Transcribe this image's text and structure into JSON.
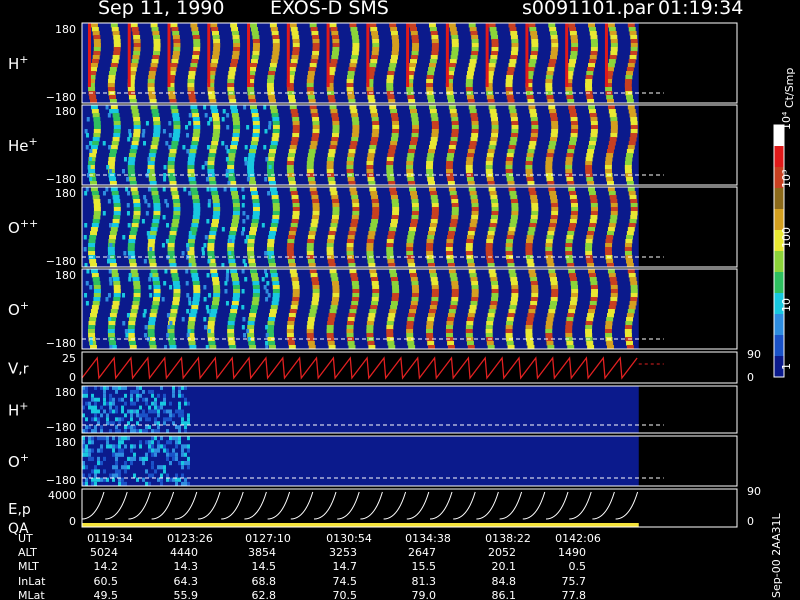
{
  "header": {
    "date": "Sep 11, 1990",
    "instrument": "EXOS-D SMS",
    "file": "s0091101.par",
    "time": "01:19:34"
  },
  "sponsor": "Sep-00 2AA31L",
  "colors": {
    "background": "#000000",
    "no_data": "#0b1a8c",
    "axis": "#ffffff",
    "velocity_trace": "#e02020",
    "energy_trace": "#ffffff",
    "qa_bar": "#f5e33a",
    "reference_line": "#ffffff"
  },
  "colorbar": {
    "unit": "Ct/Smp",
    "tick_labels": [
      "1",
      "10",
      "100",
      "10³",
      "10⁴"
    ],
    "scale": "log",
    "range": [
      1,
      10000
    ]
  },
  "chart_data": {
    "type": "heatmap",
    "title": "Sep 11, 1990  EXOS-D SMS",
    "x_axis": {
      "name": "UT",
      "tick_labels": [
        "0119:34",
        "0123:26",
        "0127:10",
        "0130:54",
        "0134:38",
        "0138:22",
        "0142:06"
      ]
    },
    "ephemeris": [
      {
        "name": "UT",
        "values": [
          "0119:34",
          "0123:26",
          "0127:10",
          "0130:54",
          "0134:38",
          "0138:22",
          "0142:06"
        ]
      },
      {
        "name": "ALT",
        "values": [
          "5024",
          "4440",
          "3854",
          "3253",
          "2647",
          "2052",
          "1490"
        ]
      },
      {
        "name": "MLT",
        "values": [
          "14.2",
          "14.3",
          "14.5",
          "14.7",
          "15.5",
          "20.1",
          "0.5"
        ]
      },
      {
        "name": "InLat",
        "values": [
          "60.5",
          "64.3",
          "68.8",
          "74.5",
          "81.3",
          "84.8",
          "75.7"
        ]
      },
      {
        "name": "MLat",
        "values": [
          "49.5",
          "55.9",
          "62.8",
          "70.5",
          "79.0",
          "86.1",
          "77.8"
        ]
      }
    ],
    "panels": [
      {
        "label": "H",
        "label_sup": "+",
        "kind": "angle_spectrogram",
        "y_top": "180",
        "y_bottom": "−180",
        "intensity": "high",
        "data_end_fraction": 0.85
      },
      {
        "label": "He",
        "label_sup": "+",
        "kind": "angle_spectrogram",
        "y_top": "180",
        "y_bottom": "−180",
        "intensity": "medium",
        "data_end_fraction": 0.85
      },
      {
        "label": "O",
        "label_sup": "++",
        "kind": "angle_spectrogram",
        "y_top": "180",
        "y_bottom": "−180",
        "intensity": "medium",
        "data_end_fraction": 0.85
      },
      {
        "label": "O",
        "label_sup": "+",
        "kind": "angle_spectrogram",
        "y_top": "180",
        "y_bottom": "−180",
        "intensity": "medium",
        "data_end_fraction": 0.85
      },
      {
        "label": "V",
        "label_sub": "r",
        "kind": "line",
        "y_top": "25",
        "y_bottom": "0",
        "right_top": "90",
        "right_bottom": "0",
        "data_end_fraction": 0.85
      },
      {
        "label": "H",
        "label_sup": "+",
        "kind": "energy_spectrogram",
        "y_top": "180",
        "y_bottom": "−180",
        "data_end_fraction": 0.85
      },
      {
        "label": "O",
        "label_sup": "+",
        "kind": "energy_spectrogram",
        "y_top": "180",
        "y_bottom": "−180",
        "data_end_fraction": 0.85
      },
      {
        "label": "E",
        "label_sub": "p",
        "label2": "QA",
        "kind": "energy_line",
        "y_top": "4000",
        "y_bottom": "0",
        "right_top": "90",
        "right_bottom": "0",
        "data_end_fraction": 0.85
      }
    ],
    "grid": false
  }
}
